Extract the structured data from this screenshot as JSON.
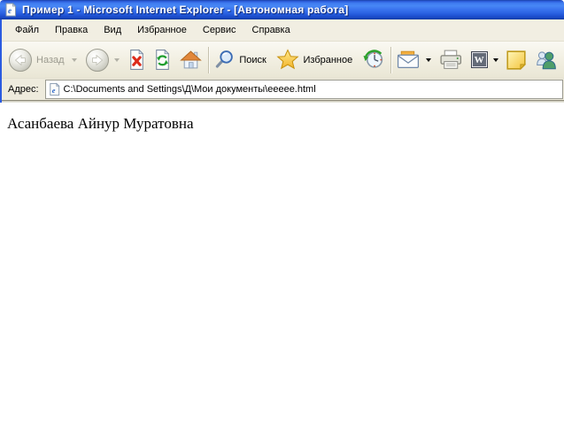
{
  "window": {
    "title": "Пример 1 - Microsoft Internet Explorer - [Автономная работа]"
  },
  "menubar": {
    "items": [
      "Файл",
      "Правка",
      "Вид",
      "Избранное",
      "Сервис",
      "Справка"
    ]
  },
  "toolbar": {
    "back_label": "Назад",
    "search_label": "Поиск",
    "favorites_label": "Избранное",
    "edit_word_letter": "W",
    "icons": [
      "back-icon",
      "forward-icon",
      "stop-icon",
      "refresh-icon",
      "home-icon",
      "search-icon",
      "favorites-star-icon",
      "history-icon",
      "mail-icon",
      "print-icon",
      "edit-with-word-icon",
      "notes-icon",
      "messenger-icon"
    ],
    "back_enabled": false,
    "forward_enabled": false
  },
  "addressbar": {
    "label": "Адрес:",
    "value": "C:\\Documents and Settings\\Д\\Мои документы\\eeeee.html"
  },
  "page": {
    "text": "Асанбаева Айнур Муратовна"
  },
  "colors": {
    "titlebar_blue": "#2a62e2",
    "chrome_beige": "#f0ede0",
    "disabled_text": "#9b9a8f",
    "stop_red": "#dc2a1a",
    "refresh_green": "#1f9e2e",
    "favorites_gold": "#ffd54a",
    "address_border": "#9a9a90"
  }
}
